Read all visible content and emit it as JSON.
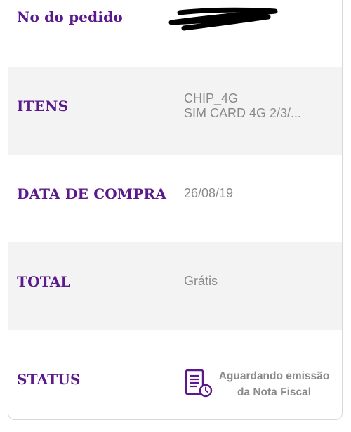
{
  "order": {
    "rows": [
      {
        "label": "No do pedido",
        "value": ""
      },
      {
        "label": "ITENS",
        "value_line1": "CHIP_4G",
        "value_line2": "SIM CARD 4G 2/3/..."
      },
      {
        "label": "DATA DE COMPRA",
        "value": "26/08/19"
      },
      {
        "label": "TOTAL",
        "value": "Grátis"
      },
      {
        "label": "STATUS",
        "value_line1": "Aguardando emissão",
        "value_line2": "da Nota Fiscal"
      }
    ]
  },
  "icons": {
    "redaction": "redaction-scribble",
    "status": "invoice-clock-icon"
  },
  "colors": {
    "label": "#5b1a8c",
    "value": "#8a8a8a",
    "row_shaded": "#f3f3f3",
    "row_plain": "#ffffff",
    "icon": "#5b1a8c"
  }
}
